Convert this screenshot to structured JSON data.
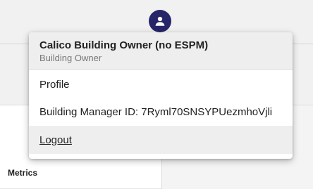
{
  "header": {
    "avatar_icon": "user-icon",
    "avatar_color": "#262668"
  },
  "main": {
    "metrics_label": "Metrics"
  },
  "user_menu": {
    "user_name": "Calico Building Owner (no ESPM)",
    "user_role": "Building Owner",
    "items": [
      {
        "label": "Profile"
      },
      {
        "label": "Building Manager ID: 7Ryml70SNSYPUezmhoVjli"
      },
      {
        "label": "Logout"
      }
    ]
  }
}
